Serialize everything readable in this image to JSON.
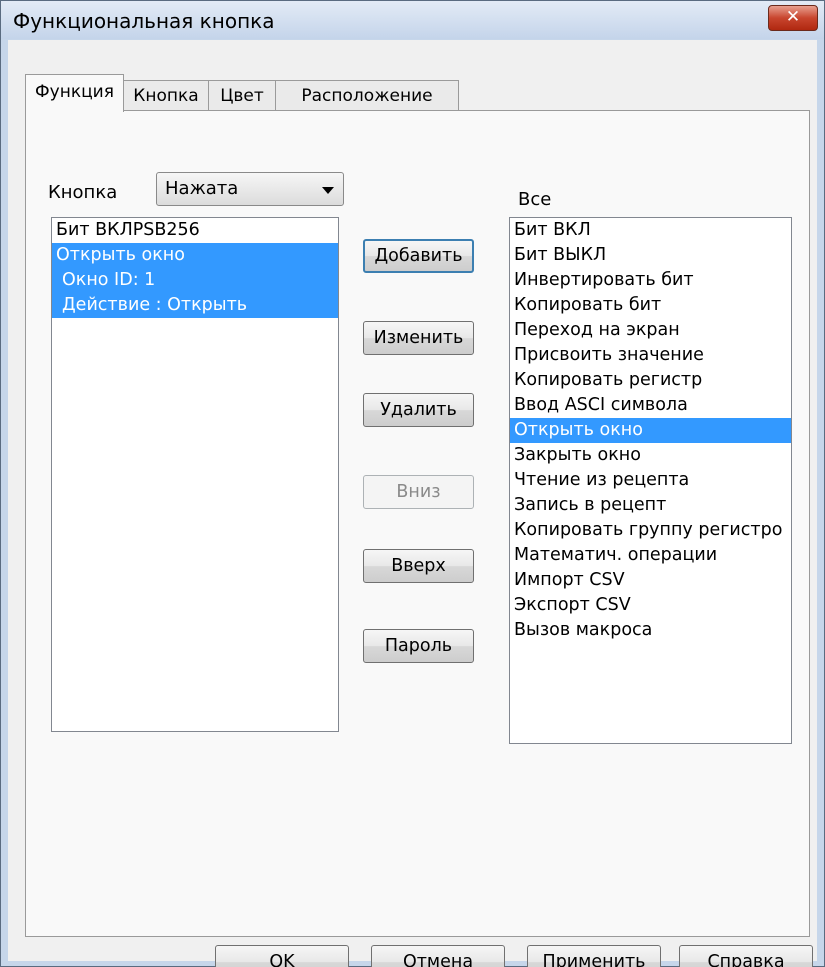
{
  "window": {
    "title": "Функциональная кнопка",
    "close_glyph": "✕"
  },
  "tabs": [
    {
      "label": "Функция",
      "active": true
    },
    {
      "label": "Кнопка",
      "active": false
    },
    {
      "label": "Цвет",
      "active": false
    },
    {
      "label": "Расположение",
      "active": false
    }
  ],
  "button_state": {
    "label": "Кнопка",
    "selected": "Нажата"
  },
  "assigned_list": [
    {
      "text": "Бит ВКЛPSB256",
      "selected": false,
      "indent": false
    },
    {
      "text": "Открыть окно",
      "selected": true,
      "indent": false
    },
    {
      "text": "Окно ID: 1",
      "selected": true,
      "indent": true
    },
    {
      "text": "Действие : Открыть",
      "selected": true,
      "indent": true
    }
  ],
  "actions": {
    "add": "Добавить",
    "edit": "Изменить",
    "delete": "Удалить",
    "down": "Вниз",
    "up": "Вверх",
    "password": "Пароль"
  },
  "all_functions": {
    "label": "Все",
    "items": [
      "Бит ВКЛ",
      "Бит ВЫКЛ",
      "Инвертировать бит",
      "Копировать бит",
      "Переход на экран",
      "Присвоить значение",
      "Копировать регистр",
      "Ввод ASCI символа",
      "Открыть окно",
      "Закрыть окно",
      "Чтение из рецепта",
      "Запись в рецепт",
      "Копировать группу регистро",
      "Математич. операции",
      "Импорт CSV",
      "Экспорт CSV",
      "Вызов макроса"
    ],
    "selected": "Открыть окно"
  },
  "footer": {
    "ok": "OK",
    "cancel": "Отмена",
    "apply": "Применить",
    "help": "Справка"
  },
  "colors": {
    "selection": "#3399ff",
    "default_button_border": "#3c7fb1",
    "close_button": "#c8452e"
  }
}
